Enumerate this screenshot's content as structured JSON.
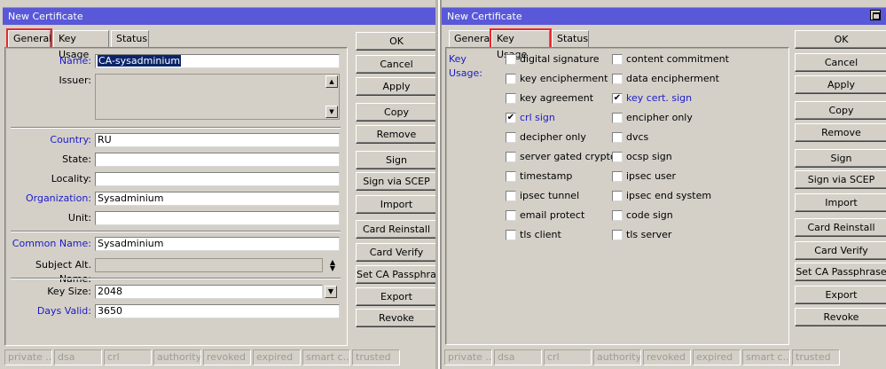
{
  "left": {
    "title": "New Certificate",
    "tabs": {
      "general": "General",
      "key_usage": "Key Usage",
      "status": "Status"
    },
    "fields": {
      "name_label": "Name:",
      "name_value": "CA-sysadminium",
      "issuer_label": "Issuer:",
      "country_label": "Country:",
      "country_value": "RU",
      "state_label": "State:",
      "locality_label": "Locality:",
      "org_label": "Organization:",
      "org_value": "Sysadminium",
      "unit_label": "Unit:",
      "cn_label": "Common Name:",
      "cn_value": "Sysadminium",
      "san_label": "Subject Alt. Name:",
      "keysize_label": "Key Size:",
      "keysize_value": "2048",
      "days_label": "Days Valid:",
      "days_value": "3650"
    },
    "buttons": [
      "OK",
      "Cancel",
      "Apply",
      "Copy",
      "Remove",
      "Sign",
      "Sign via SCEP",
      "Import",
      "Card Reinstall",
      "Card Verify",
      "Set CA Passphrase",
      "Export",
      "Revoke"
    ],
    "status": [
      "private ...",
      "dsa",
      "crl",
      "authority",
      "revoked",
      "expired",
      "smart c...",
      "trusted"
    ]
  },
  "right": {
    "title": "New Certificate",
    "tabs": {
      "general": "General",
      "key_usage": "Key Usage",
      "status": "Status"
    },
    "key_usage_label": "Key Usage:",
    "options_left": [
      {
        "label": "digital signature",
        "checked": false
      },
      {
        "label": "key encipherment",
        "checked": false
      },
      {
        "label": "key agreement",
        "checked": false
      },
      {
        "label": "crl sign",
        "checked": true
      },
      {
        "label": "decipher only",
        "checked": false
      },
      {
        "label": "server gated crypto",
        "checked": false
      },
      {
        "label": "timestamp",
        "checked": false
      },
      {
        "label": "ipsec tunnel",
        "checked": false
      },
      {
        "label": "email protect",
        "checked": false
      },
      {
        "label": "tls client",
        "checked": false
      }
    ],
    "options_right": [
      {
        "label": "content commitment",
        "checked": false
      },
      {
        "label": "data encipherment",
        "checked": false
      },
      {
        "label": "key cert. sign",
        "checked": true
      },
      {
        "label": "encipher only",
        "checked": false
      },
      {
        "label": "dvcs",
        "checked": false
      },
      {
        "label": "ocsp sign",
        "checked": false
      },
      {
        "label": "ipsec user",
        "checked": false
      },
      {
        "label": "ipsec end system",
        "checked": false
      },
      {
        "label": "code sign",
        "checked": false
      },
      {
        "label": "tls server",
        "checked": false
      }
    ],
    "buttons": [
      "OK",
      "Cancel",
      "Apply",
      "Copy",
      "Remove",
      "Sign",
      "Sign via SCEP",
      "Import",
      "Card Reinstall",
      "Card Verify",
      "Set CA Passphrase",
      "Export",
      "Revoke"
    ],
    "status": [
      "private ...",
      "dsa",
      "crl",
      "authority",
      "revoked",
      "expired",
      "smart c...",
      "trusted"
    ]
  }
}
